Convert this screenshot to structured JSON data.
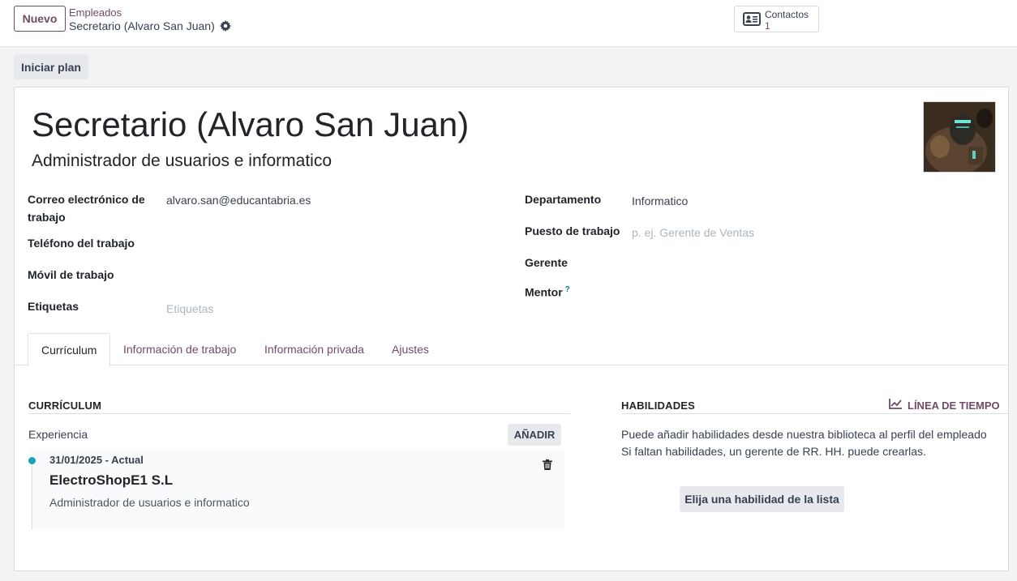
{
  "topbar": {
    "new_label": "Nuevo",
    "breadcrumb_parent": "Empleados",
    "breadcrumb_current": "Secretario (Alvaro San Juan)",
    "contacts_label": "Contactos",
    "contacts_count": "1"
  },
  "actions": {
    "start_plan_label": "Iniciar plan"
  },
  "employee": {
    "name": "Secretario (Alvaro San Juan)",
    "job_title": "Administrador de usuarios e informatico"
  },
  "fields_left": {
    "work_email_label_line1": "Correo electrónico de",
    "work_email_label_line2": "trabajo",
    "work_email_value": "alvaro.san@educantabria.es",
    "work_phone_label": "Teléfono del trabajo",
    "work_mobile_label": "Móvil de trabajo",
    "tags_label": "Etiquetas",
    "tags_placeholder": "Etiquetas"
  },
  "fields_right": {
    "department_label": "Departamento",
    "department_value": "Informatico",
    "job_position_label": "Puesto de trabajo",
    "job_position_placeholder": "p. ej. Gerente de Ventas",
    "manager_label": "Gerente",
    "mentor_label": "Mentor",
    "mentor_help": "?"
  },
  "tabs": [
    "Currículum",
    "Información de trabajo",
    "Información privada",
    "Ajustes"
  ],
  "resume": {
    "section_title": "CURRÍCULUM",
    "experience_label": "Experiencia",
    "add_label": "AÑADIR",
    "entries": [
      {
        "dates": "31/01/2025 - Actual",
        "company": "ElectroShopE1 S.L",
        "description": "Administrador de usuarios e informatico"
      }
    ]
  },
  "skills": {
    "section_title": "HABILIDADES",
    "timeline_label": "LÍNEA DE TIEMPO",
    "info_line1": "Puede añadir habilidades desde nuestra biblioteca al perfil del empleado",
    "info_line2": "Si faltan habilidades, un gerente de RR. HH. puede crearlas.",
    "pick_label": "Elija una habilidad de la lista"
  },
  "colors": {
    "accent": "#714b67",
    "timeline_dot": "#17a2b8"
  },
  "icons": {
    "gear": "gear-icon",
    "contacts": "id-card-icon",
    "trash": "trash-icon",
    "timeline": "line-chart-icon"
  }
}
